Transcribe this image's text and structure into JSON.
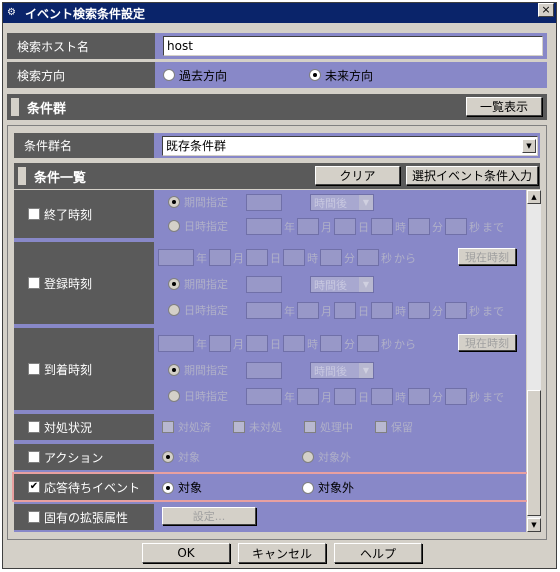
{
  "window": {
    "title": "イベント検索条件設定",
    "close": "×"
  },
  "host": {
    "label": "検索ホスト名",
    "value": "host"
  },
  "direction": {
    "label": "検索方向",
    "past": "過去方向",
    "future": "未来方向"
  },
  "group": {
    "title": "条件群",
    "list_btn": "一覧表示",
    "name_label": "条件群名",
    "name_value": "既存条件群"
  },
  "list": {
    "title": "条件一覧",
    "clear_btn": "クリア",
    "select_btn": "選択イベント条件入力"
  },
  "time_units": {
    "year": "年",
    "month": "月",
    "day": "日",
    "hour": "時",
    "minute": "分",
    "second": "秒",
    "until": "まで",
    "from": "から",
    "period": "期間指定",
    "datetime": "日時指定",
    "after": "時間後",
    "now": "現在時刻"
  },
  "rows": {
    "end_time": "終了時刻",
    "reg_time": "登録時刻",
    "arr_time": "到着時刻",
    "status": {
      "label": "対処状況",
      "opts": [
        "対処済",
        "未対処",
        "処理中",
        "保留"
      ]
    },
    "action": {
      "label": "アクション",
      "target": "対象",
      "nontarget": "対象外"
    },
    "waiting": {
      "label": "応答待ちイベント",
      "target": "対象",
      "nontarget": "対象外",
      "check": "✔"
    },
    "ext": {
      "label": "固有の拡張属性",
      "btn": "設定..."
    }
  },
  "footer": {
    "ok": "OK",
    "cancel": "キャンセル",
    "help": "ヘルプ"
  },
  "icons": {
    "dropdown": "▼",
    "up": "▲",
    "down": "▼"
  }
}
